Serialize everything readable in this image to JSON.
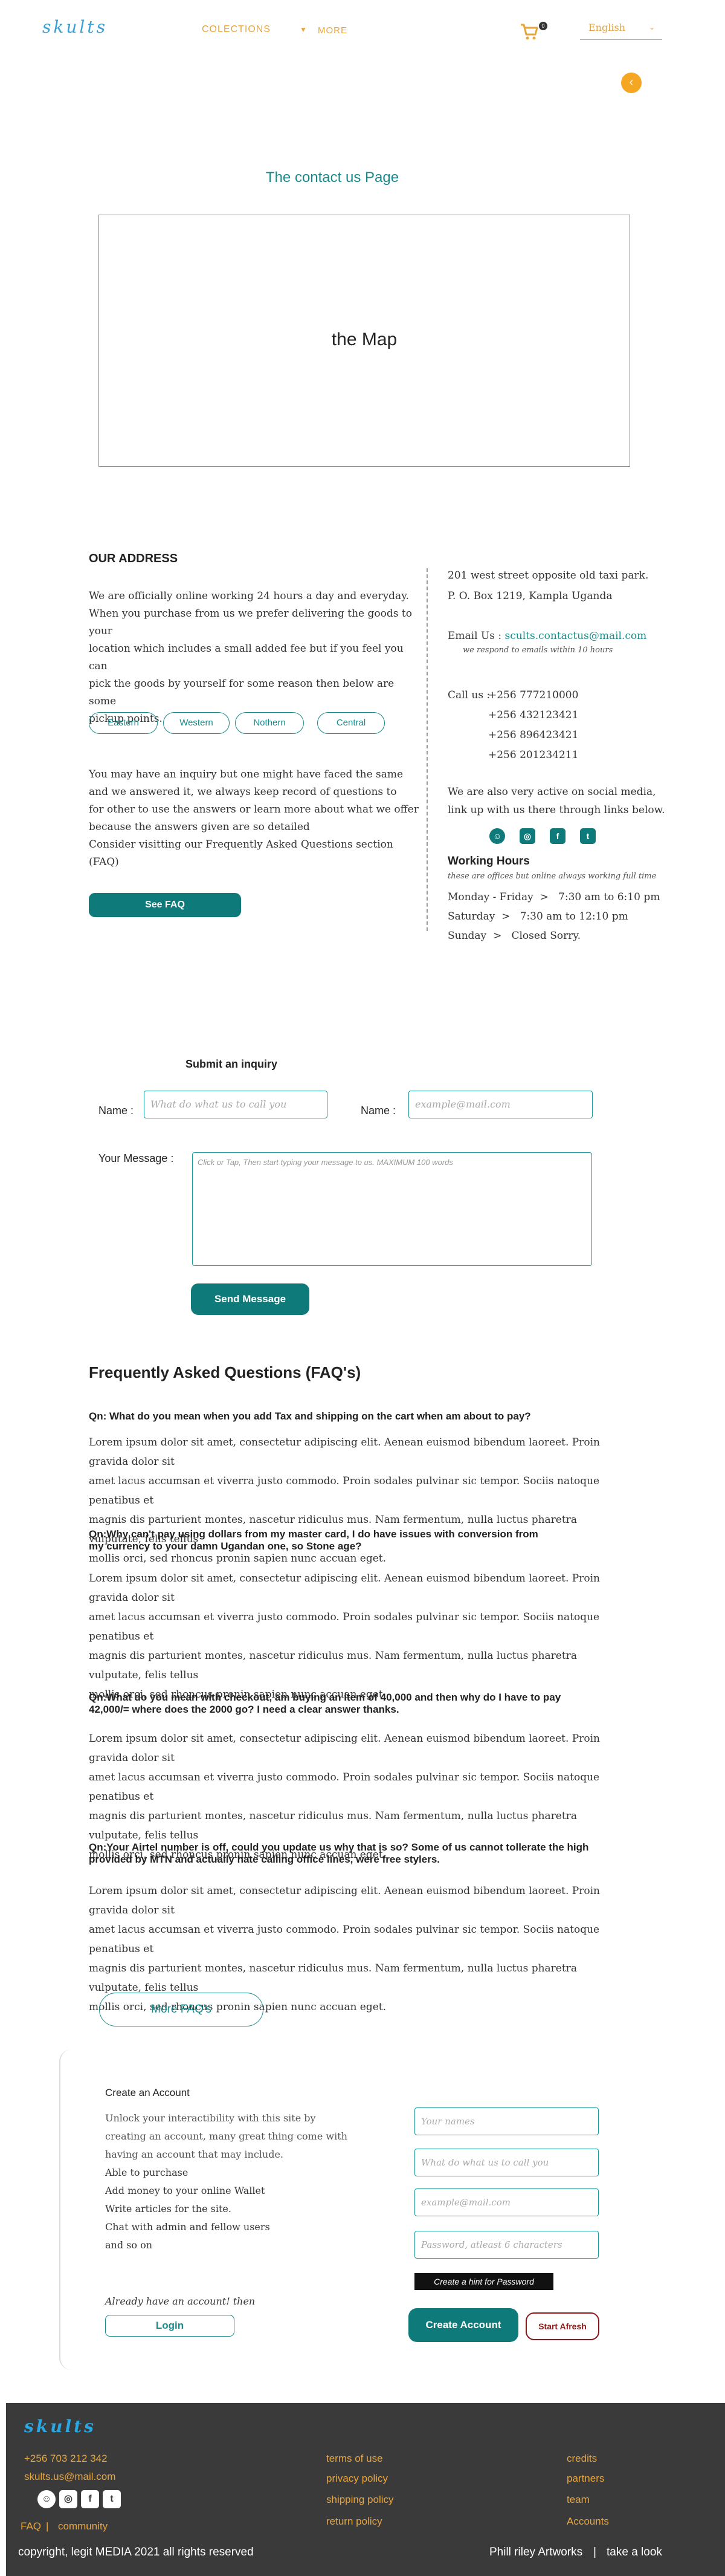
{
  "header": {
    "logo": "skults",
    "nav": [
      "COLECTIONS",
      "MORE"
    ],
    "cart_count": "0",
    "language": "English"
  },
  "page_title": "The contact us Page",
  "map_label": "the Map",
  "address": {
    "heading": "OUR ADDRESS",
    "intro": [
      "We are officially online working 24 hours a day and everyday.",
      "When you purchase from us we prefer delivering the goods to your",
      "location which includes a small added fee but if you feel you can",
      "pick the goods by yourself for some reason then below are some",
      "pickup points."
    ],
    "regions": [
      "Eastern",
      "Western",
      "Nothern",
      "Central"
    ],
    "inquiry_text": [
      "You may have an inquiry  but one might have faced the same",
      "and we answered it, we always keep record of questions to",
      "for other to use the answers or learn more about what we offer",
      "because the answers given are so detailed",
      "Consider visitting our Frequently Asked Questions section (FAQ)"
    ],
    "see_faq": "See FAQ"
  },
  "contact": {
    "street": "201 west street opposite old taxi park.",
    "po_box": "P. O. Box 1219, Kampla Uganda",
    "email_label": "Email Us :",
    "email": "scults.contactus@mail.com",
    "email_note": "we respond to emails within  10 hours",
    "call_label": "Call us :",
    "phones": [
      "+256 777210000",
      "+256 432123421",
      "+256 896423421",
      "+256 201234211"
    ],
    "social_text": [
      "We are also very active on social media,",
      "link up with us there through links below."
    ],
    "hours_heading": "Working Hours",
    "hours_note": "these are offices but online always working full time",
    "hours": [
      {
        "day": "Monday - Friday",
        "sep": ">",
        "time": "7:30 am to 6:10 pm"
      },
      {
        "day": "Saturday",
        "sep": ">",
        "time": "7:30 am to 12:10 pm"
      },
      {
        "day": "Sunday",
        "sep": ">",
        "time": "Closed Sorry."
      }
    ]
  },
  "inquiry": {
    "title": "Submit an inquiry",
    "name_label": "Name :",
    "name_placeholder": "What do what us to call you",
    "email_label": "Name :",
    "email_placeholder": "example@mail.com",
    "message_label": "Your Message :",
    "message_placeholder": "Click or Tap, Then start typing your message to us. MAXIMUM 100 words",
    "send": "Send Message"
  },
  "faq": {
    "heading": "Frequently Asked Questions (FAQ's)",
    "items": [
      {
        "q1": "Qn: What do you mean when you add Tax and shipping on the cart when am about to pay?",
        "q2": ""
      },
      {
        "q1": "Qn:Why can't pay using dollars from my master card, I do have issues with conversion from",
        "q2": "my currency to your damn Ugandan one, so Stone age?"
      },
      {
        "q1": "Qn:What do you mean with checkout, am buying an item of 40,000 and then why do I have to pay",
        "q2": "42,000/= where does the 2000 go? I need a clear answer thanks."
      },
      {
        "q1": "Qn:Your Airtel number is off, could you update us why that is so? Some of us cannot tollerate the high",
        "q2": "provided by MTN and actually hate calling office lines, were free stylers."
      }
    ],
    "answer_lines": [
      "Lorem ipsum dolor sit amet, consectetur adipiscing elit. Aenean euismod bibendum laoreet. Proin gravida dolor sit",
      "amet lacus accumsan et viverra justo commodo. Proin sodales pulvinar sic tempor. Sociis natoque penatibus et",
      "magnis dis parturient montes, nascetur ridiculus mus. Nam fermentum, nulla luctus pharetra vulputate, felis tellus",
      "mollis orci, sed rhoncus pronin sapien nunc accuan eget."
    ],
    "more": "More FAQ's"
  },
  "account": {
    "heading": "Create an Account",
    "lines": [
      "Unlock your interactibility with this site by",
      "creating an account, many great thing come with",
      "having an account that may include.",
      "Able to purchase",
      "Add money to your online Wallet",
      "Write articles for the site.",
      "Chat with admin and fellow users",
      "and so on"
    ],
    "have_account": "Already have an account! then",
    "login": "Login",
    "placeholders": [
      "Your names",
      "What do what us to call you",
      "example@mail.com",
      "Password, atleast 6 characters"
    ],
    "hint": "Create a hint for Password",
    "create": "Create Account",
    "afresh": "Start Afresh"
  },
  "footer": {
    "logo": "skults",
    "phone": "+256 703 212 342",
    "email": "skults.us@mail.com",
    "faq": "FAQ",
    "sep": "|",
    "community": "community",
    "col2": [
      "terms of use",
      "privacy policy",
      "shipping policy",
      "return policy"
    ],
    "col3": [
      "credits",
      "partners",
      "team",
      "Accounts"
    ],
    "copyright": "copyright, legit MEDIA 2021 all rights reserved",
    "artworks": "Phill riley Artworks",
    "sep2": "|",
    "look": "take a look"
  },
  "colors": {
    "teal": "#0e7a7a",
    "orange": "#e8a53c",
    "brown": "#8b4513",
    "footer_bg": "#3a3a3a"
  }
}
